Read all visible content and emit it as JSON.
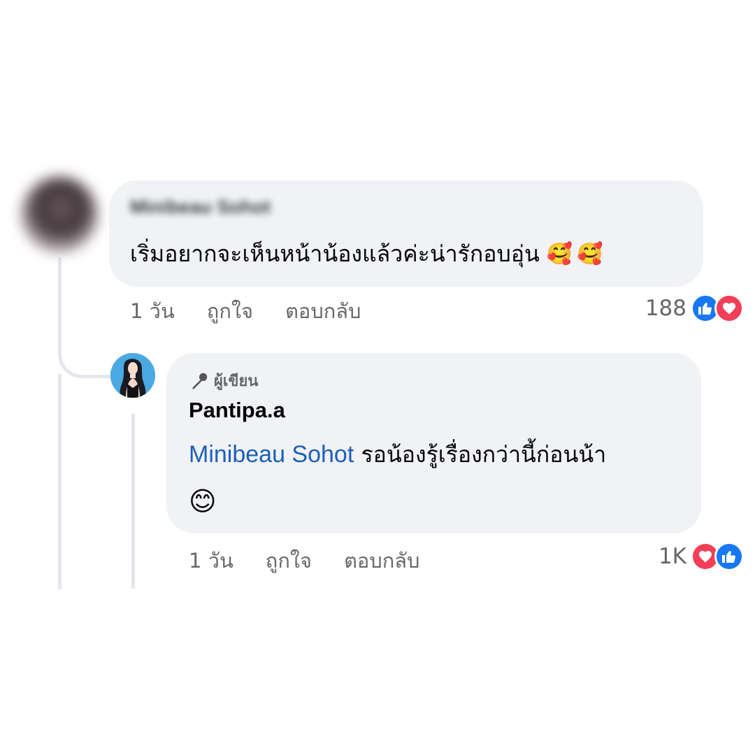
{
  "comment": {
    "author_name": "Minibeau Sohot",
    "text": "เริ่มอยากจะเห็นหน้าน้องแล้วค่ะน่ารักอบอุ่น",
    "emoji": "🥰",
    "time": "1 วัน",
    "like_label": "ถูกใจ",
    "reply_label": "ตอบกลับ",
    "reaction_count": "188",
    "reaction_icons": [
      "like-icon",
      "love-icon"
    ]
  },
  "reply": {
    "badge_label": "ผู้เขียน",
    "author_name": "Pantipa.a",
    "mention": "Minibeau Sohot",
    "text": "รอน้องรู้เรื่องกว่านี้ก่อนน้า",
    "emoji": "😊",
    "time": "1 วัน",
    "like_label": "ถูกใจ",
    "reply_label": "ตอบกลับ",
    "reaction_count": "1K",
    "reaction_icons": [
      "love-icon",
      "like-icon"
    ]
  },
  "colors": {
    "bubble": "#f0f2f5",
    "mention": "#1d5fb8",
    "meta_text": "#65676b",
    "like": "#1877f2",
    "love": "#f33e58",
    "thread_line": "#e4e6eb"
  }
}
